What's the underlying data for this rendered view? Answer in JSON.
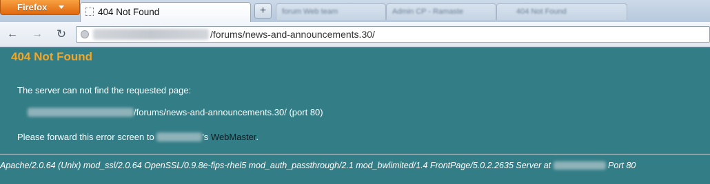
{
  "browser": {
    "menu_button": "Firefox",
    "active_tab": {
      "title": "404 Not Found"
    },
    "new_tab_label": "+",
    "background_tabs": [
      {
        "title": "forum Web team"
      },
      {
        "title": "Admin CP - Ramaste"
      },
      {
        "title": "404 Not Found"
      }
    ],
    "url_visible_path": "/forums/news-and-announcements.30/"
  },
  "page": {
    "heading": "404 Not Found",
    "message_line1": "The server can not find the requested page:",
    "requested_path": "/forums/news-and-announcements.30/",
    "port_note": " (port 80)",
    "forward_prefix": "Please forward this error screen to ",
    "possessive_suffix": "'s ",
    "webmaster_link": "WebMaster",
    "trailing_period": ".",
    "server_signature": "Apache/2.0.64 (Unix) mod_ssl/2.0.64 OpenSSL/0.9.8e-fips-rhel5 mod_auth_passthrough/2.1 mod_bwlimited/1.4 FrontPage/5.0.2.2635 Server at ",
    "server_port": " Port 80"
  },
  "colors": {
    "background": "#337d87",
    "heading": "#f5a623",
    "firefox_button": "#e8781a",
    "link": "#111a1c"
  }
}
